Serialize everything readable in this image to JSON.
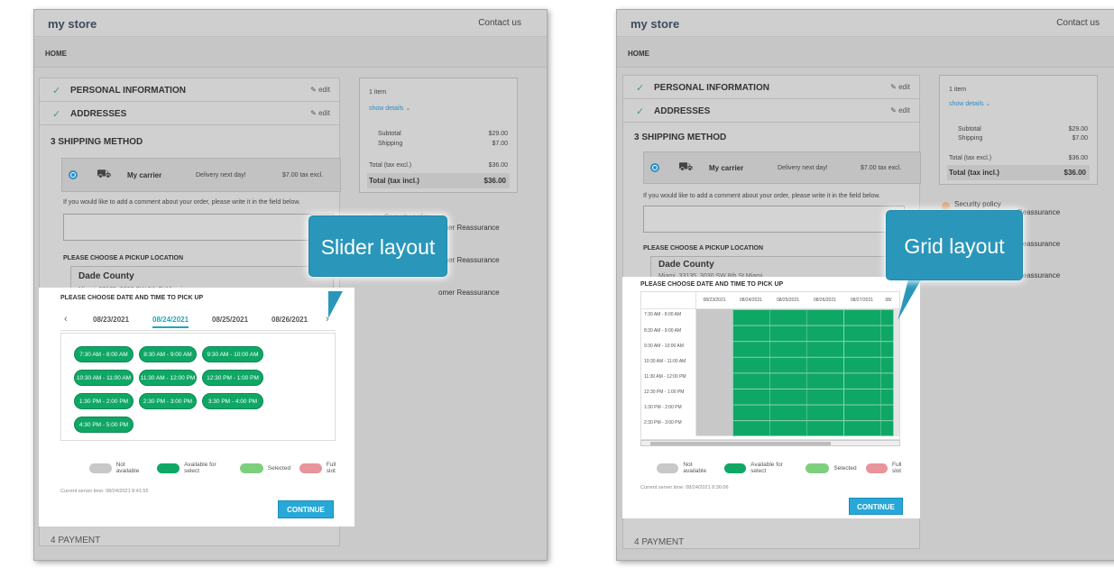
{
  "store": {
    "logo": "my store",
    "contact": "Contact us",
    "breadcrumb": "HOME"
  },
  "steps": {
    "personal": "PERSONAL INFORMATION",
    "addresses": "ADDRESSES",
    "edit": "edit",
    "shipping": "3  SHIPPING METHOD",
    "payment": "4  PAYMENT"
  },
  "carrier": {
    "name": "My carrier",
    "delay": "Delivery next day!",
    "price": "$7.00 tax excl."
  },
  "comment_text": "If you would like to add a comment about your order, please write it in the field below.",
  "pickup": {
    "heading": "PLEASE CHOOSE A PICKUP LOCATION",
    "name": "Dade County",
    "address": "Miami, 33135, 3030 SW 8th St Miami"
  },
  "summary": {
    "items": "1 item",
    "show_details": "show details",
    "subtotal_label": "Subtotal",
    "subtotal": "$29.00",
    "shipping_label": "Shipping",
    "shipping": "$7.00",
    "excl_label": "Total (tax excl.)",
    "excl": "$36.00",
    "incl_label": "Total (tax incl.)",
    "incl": "$36.00"
  },
  "reassurance": {
    "security": "Security policy",
    "suffix_full": "omer Reassurance",
    "suffix_short": "Reassurance"
  },
  "datetime_heading": "PLEASE CHOOSE DATE AND TIME TO PICK UP",
  "slider": {
    "callout": "Slider layout",
    "dates": [
      "08/23/2021",
      "08/24/2021",
      "08/25/2021",
      "08/26/2021"
    ],
    "active_date": "08/24/2021",
    "slots": [
      "7:30 AM - 8:00 AM",
      "8:30 AM - 9:00 AM",
      "9:30 AM - 10:00 AM",
      "10:30 AM - 11:00 AM",
      "11:30 AM - 12:00 PM",
      "12:30 PM - 1:00 PM",
      "1:30 PM - 2:00 PM",
      "2:30 PM - 3:00 PM",
      "3:30 PM - 4:00 PM",
      "4:30 PM - 5:00 PM"
    ],
    "server_time": "Current server time: 08/24/2021 8:41:55"
  },
  "grid": {
    "callout": "Grid layout",
    "dates": [
      "08/23/2021",
      "08/24/2021",
      "08/25/2021",
      "08/26/2021",
      "08/27/2021",
      "08/"
    ],
    "times": [
      "7:30 AM - 8:00 AM",
      "8:30 AM - 9:00 AM",
      "9:30 AM - 10:00 AM",
      "10:30 AM - 11:00 AM",
      "11:30 AM - 12:00 PM",
      "12:30 PM - 1:00 PM",
      "1:30 PM - 2:00 PM",
      "2:30 PM - 3:00 PM"
    ],
    "server_time": "Current server time: 08/24/2021 8:36:06"
  },
  "legend": {
    "na": "Not available",
    "avail": "Available for select",
    "sel": "Selected",
    "full": "Full slot"
  },
  "continue": "CONTINUE",
  "colors": {
    "available": "#0fa765",
    "selected": "#7dcf7e",
    "full": "#e8949b",
    "not_available": "#c8c8c8",
    "accent": "#28a8d8",
    "callout": "#2a97ba"
  }
}
